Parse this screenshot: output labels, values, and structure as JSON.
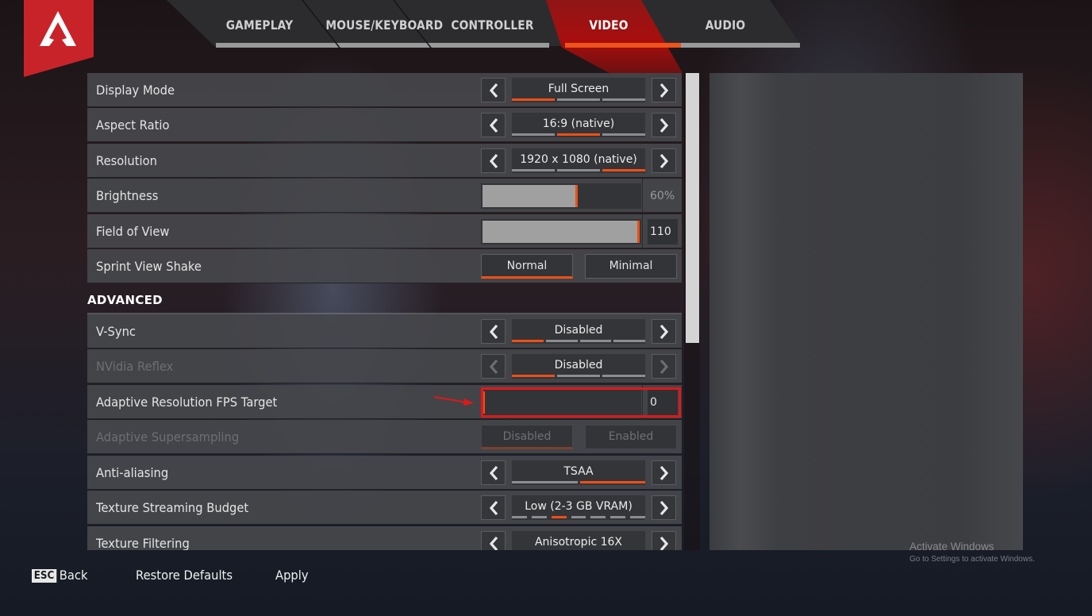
{
  "logo": {
    "icon": "apex-legends-logo"
  },
  "tabs": [
    {
      "label": "GAMEPLAY",
      "active": false
    },
    {
      "label": "MOUSE/KEYBOARD",
      "active": false
    },
    {
      "label": "CONTROLLER",
      "active": false
    },
    {
      "label": "VIDEO",
      "active": true
    },
    {
      "label": "AUDIO",
      "active": false
    }
  ],
  "settings": {
    "display_mode": {
      "label": "Display Mode",
      "value": "Full Screen",
      "options_count": 3,
      "selected_index": 0
    },
    "aspect_ratio": {
      "label": "Aspect Ratio",
      "value": "16:9 (native)",
      "options_count": 3,
      "selected_index": 1
    },
    "resolution": {
      "label": "Resolution",
      "value": "1920 x 1080 (native)",
      "options_count": 3,
      "selected_index": 2
    },
    "brightness": {
      "label": "Brightness",
      "value_text": "60%",
      "fraction": 0.6
    },
    "field_of_view": {
      "label": "Field of View",
      "value_text": "110",
      "fraction": 1.0
    },
    "sprint_view_shake": {
      "label": "Sprint View Shake",
      "options": [
        "Normal",
        "Minimal"
      ],
      "selected": "Normal"
    },
    "advanced_title": "ADVANCED",
    "vsync": {
      "label": "V-Sync",
      "value": "Disabled",
      "options_count": 4,
      "selected_index": 0
    },
    "nvidia_reflex": {
      "label": "NVidia Reflex",
      "value": "Disabled",
      "options_count": 3,
      "selected_index": 0,
      "disabled": true
    },
    "adaptive_res_fps": {
      "label": "Adaptive Resolution FPS Target",
      "value_text": "0",
      "fraction": 0.0
    },
    "adaptive_supersampling": {
      "label": "Adaptive Supersampling",
      "options": [
        "Disabled",
        "Enabled"
      ],
      "selected": "Disabled",
      "disabled": true
    },
    "anti_aliasing": {
      "label": "Anti-aliasing",
      "value": "TSAA",
      "options_count": 2,
      "selected_index": 1
    },
    "texture_streaming_budget": {
      "label": "Texture Streaming Budget",
      "value": "Low (2-3 GB VRAM)",
      "options_count": 7,
      "selected_index": 2
    },
    "texture_filtering": {
      "label": "Texture Filtering",
      "value": "Anisotropic 16X"
    }
  },
  "footer": {
    "esc_key": "ESC",
    "back": "Back",
    "restore_defaults": "Restore Defaults",
    "apply": "Apply"
  },
  "watermark": {
    "title": "Activate Windows",
    "subtitle": "Go to Settings to activate Windows."
  },
  "colors": {
    "accent": "#ee4f16",
    "brand_red": "#c9232a",
    "highlight": "#e01818"
  }
}
